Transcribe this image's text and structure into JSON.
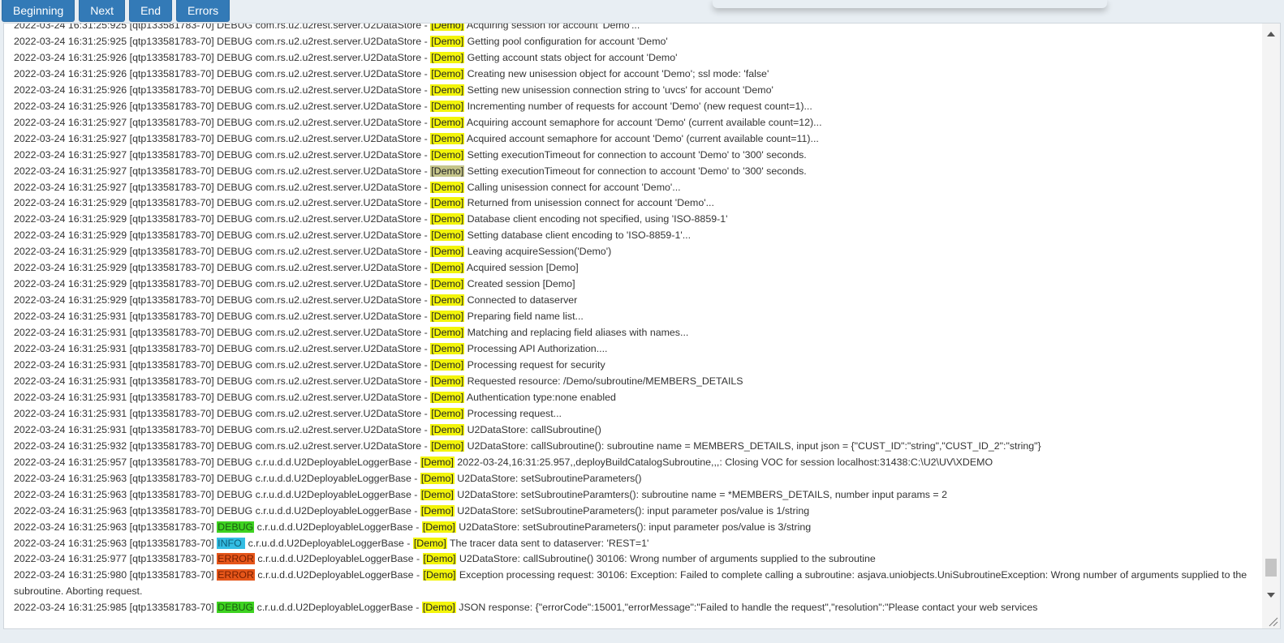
{
  "toolbar": {
    "buttons": [
      "Beginning",
      "Next",
      "End",
      "Errors"
    ]
  },
  "colors": {
    "debug_highlight": "#3ed321",
    "info_highlight": "#33bde3",
    "error_highlight": "#e5561a",
    "account_highlight": "#f3f50a",
    "button": "#337ab7"
  },
  "log": {
    "account_tag": "[Demo]",
    "lines": [
      {
        "ts": "2022-03-24 16:31:25:925",
        "thread": "[qtp133581783-70]",
        "level": "DEBUG",
        "logger": "com.rs.u2.u2rest.server.U2DataStore",
        "msg": "Acquiring session for account 'Demo'..."
      },
      {
        "ts": "2022-03-24 16:31:25:925",
        "thread": "[qtp133581783-70]",
        "level": "DEBUG",
        "logger": "com.rs.u2.u2rest.server.U2DataStore",
        "msg": "Getting pool configuration for account 'Demo'"
      },
      {
        "ts": "2022-03-24 16:31:25:926",
        "thread": "[qtp133581783-70]",
        "level": "DEBUG",
        "logger": "com.rs.u2.u2rest.server.U2DataStore",
        "msg": "Getting account stats object for account 'Demo'"
      },
      {
        "ts": "2022-03-24 16:31:25:926",
        "thread": "[qtp133581783-70]",
        "level": "DEBUG",
        "logger": "com.rs.u2.u2rest.server.U2DataStore",
        "msg": "Creating new unisession object for account 'Demo'; ssl mode: 'false'"
      },
      {
        "ts": "2022-03-24 16:31:25:926",
        "thread": "[qtp133581783-70]",
        "level": "DEBUG",
        "logger": "com.rs.u2.u2rest.server.U2DataStore",
        "msg": "Setting new unisession connection string to 'uvcs' for account 'Demo'"
      },
      {
        "ts": "2022-03-24 16:31:25:926",
        "thread": "[qtp133581783-70]",
        "level": "DEBUG",
        "logger": "com.rs.u2.u2rest.server.U2DataStore",
        "msg": "Incrementing number of requests for account 'Demo' (new request count=1)..."
      },
      {
        "ts": "2022-03-24 16:31:25:927",
        "thread": "[qtp133581783-70]",
        "level": "DEBUG",
        "logger": "com.rs.u2.u2rest.server.U2DataStore",
        "msg": "Acquiring account semaphore for account 'Demo' (current available count=12)..."
      },
      {
        "ts": "2022-03-24 16:31:25:927",
        "thread": "[qtp133581783-70]",
        "level": "DEBUG",
        "logger": "com.rs.u2.u2rest.server.U2DataStore",
        "msg": "Acquired account semaphore for account 'Demo' (current available count=11)..."
      },
      {
        "ts": "2022-03-24 16:31:25:927",
        "thread": "[qtp133581783-70]",
        "level": "DEBUG",
        "logger": "com.rs.u2.u2rest.server.U2DataStore",
        "msg": "Setting executionTimeout for connection to account 'Demo' to '300' seconds."
      },
      {
        "ts": "2022-03-24 16:31:25:927",
        "thread": "[qtp133581783-70]",
        "level": "DEBUG",
        "logger": "com.rs.u2.u2rest.server.U2DataStore",
        "msg": "Setting executionTimeout for connection to account 'Demo' to '300' seconds.",
        "selected": true
      },
      {
        "ts": "2022-03-24 16:31:25:927",
        "thread": "[qtp133581783-70]",
        "level": "DEBUG",
        "logger": "com.rs.u2.u2rest.server.U2DataStore",
        "msg": "Calling unisession connect for account 'Demo'..."
      },
      {
        "ts": "2022-03-24 16:31:25:929",
        "thread": "[qtp133581783-70]",
        "level": "DEBUG",
        "logger": "com.rs.u2.u2rest.server.U2DataStore",
        "msg": "Returned from unisession connect for account 'Demo'..."
      },
      {
        "ts": "2022-03-24 16:31:25:929",
        "thread": "[qtp133581783-70]",
        "level": "DEBUG",
        "logger": "com.rs.u2.u2rest.server.U2DataStore",
        "msg": "Database client encoding not specified, using 'ISO-8859-1'"
      },
      {
        "ts": "2022-03-24 16:31:25:929",
        "thread": "[qtp133581783-70]",
        "level": "DEBUG",
        "logger": "com.rs.u2.u2rest.server.U2DataStore",
        "msg": "Setting database client encoding to 'ISO-8859-1'..."
      },
      {
        "ts": "2022-03-24 16:31:25:929",
        "thread": "[qtp133581783-70]",
        "level": "DEBUG",
        "logger": "com.rs.u2.u2rest.server.U2DataStore",
        "msg": "Leaving acquireSession('Demo')"
      },
      {
        "ts": "2022-03-24 16:31:25:929",
        "thread": "[qtp133581783-70]",
        "level": "DEBUG",
        "logger": "com.rs.u2.u2rest.server.U2DataStore",
        "msg": "Acquired session [Demo]"
      },
      {
        "ts": "2022-03-24 16:31:25:929",
        "thread": "[qtp133581783-70]",
        "level": "DEBUG",
        "logger": "com.rs.u2.u2rest.server.U2DataStore",
        "msg": "Created session [Demo]"
      },
      {
        "ts": "2022-03-24 16:31:25:929",
        "thread": "[qtp133581783-70]",
        "level": "DEBUG",
        "logger": "com.rs.u2.u2rest.server.U2DataStore",
        "msg": "Connected to dataserver"
      },
      {
        "ts": "2022-03-24 16:31:25:931",
        "thread": "[qtp133581783-70]",
        "level": "DEBUG",
        "logger": "com.rs.u2.u2rest.server.U2DataStore",
        "msg": "Preparing field name list..."
      },
      {
        "ts": "2022-03-24 16:31:25:931",
        "thread": "[qtp133581783-70]",
        "level": "DEBUG",
        "logger": "com.rs.u2.u2rest.server.U2DataStore",
        "msg": "Matching and replacing field aliases with names..."
      },
      {
        "ts": "2022-03-24 16:31:25:931",
        "thread": "[qtp133581783-70]",
        "level": "DEBUG",
        "logger": "com.rs.u2.u2rest.server.U2DataStore",
        "msg": "Processing API Authorization...."
      },
      {
        "ts": "2022-03-24 16:31:25:931",
        "thread": "[qtp133581783-70]",
        "level": "DEBUG",
        "logger": "com.rs.u2.u2rest.server.U2DataStore",
        "msg": "Processing request for security"
      },
      {
        "ts": "2022-03-24 16:31:25:931",
        "thread": "[qtp133581783-70]",
        "level": "DEBUG",
        "logger": "com.rs.u2.u2rest.server.U2DataStore",
        "msg": "Requested resource: /Demo/subroutine/MEMBERS_DETAILS"
      },
      {
        "ts": "2022-03-24 16:31:25:931",
        "thread": "[qtp133581783-70]",
        "level": "DEBUG",
        "logger": "com.rs.u2.u2rest.server.U2DataStore",
        "msg": "Authentication type:none enabled"
      },
      {
        "ts": "2022-03-24 16:31:25:931",
        "thread": "[qtp133581783-70]",
        "level": "DEBUG",
        "logger": "com.rs.u2.u2rest.server.U2DataStore",
        "msg": "Processing request..."
      },
      {
        "ts": "2022-03-24 16:31:25:931",
        "thread": "[qtp133581783-70]",
        "level": "DEBUG",
        "logger": "com.rs.u2.u2rest.server.U2DataStore",
        "msg": "U2DataStore: callSubroutine()"
      },
      {
        "ts": "2022-03-24 16:31:25:932",
        "thread": "[qtp133581783-70]",
        "level": "DEBUG",
        "logger": "com.rs.u2.u2rest.server.U2DataStore",
        "msg": "U2DataStore: callSubroutine(): subroutine name = MEMBERS_DETAILS, input json = {\"CUST_ID\":\"string\",\"CUST_ID_2\":\"string\"}"
      },
      {
        "ts": "2022-03-24 16:31:25:957",
        "thread": "[qtp133581783-70]",
        "level": "DEBUG",
        "logger": "c.r.u.d.d.U2DeployableLoggerBase",
        "msg": "2022-03-24,16:31:25.957,,deployBuildCatalogSubroutine,,,: Closing VOC for session localhost:31438:C:\\U2\\UV\\XDEMO"
      },
      {
        "ts": "2022-03-24 16:31:25:963",
        "thread": "[qtp133581783-70]",
        "level": "DEBUG",
        "logger": "c.r.u.d.d.U2DeployableLoggerBase",
        "msg": "U2DataStore: setSubroutineParameters()"
      },
      {
        "ts": "2022-03-24 16:31:25:963",
        "thread": "[qtp133581783-70]",
        "level": "DEBUG",
        "logger": "c.r.u.d.d.U2DeployableLoggerBase",
        "msg": "U2DataStore: setSubroutineParamters(): subroutine name = *MEMBERS_DETAILS, number input params = 2"
      },
      {
        "ts": "2022-03-24 16:31:25:963",
        "thread": "[qtp133581783-70]",
        "level": "DEBUG",
        "logger": "c.r.u.d.d.U2DeployableLoggerBase",
        "msg": "U2DataStore: setSubroutineParameters(): input parameter pos/value is 1/string"
      },
      {
        "ts": "2022-03-24 16:31:25:963",
        "thread": "[qtp133581783-70]",
        "level": "DEBUG",
        "logger": "c.r.u.d.d.U2DeployableLoggerBase",
        "msg": "U2DataStore: setSubroutineParameters(): input parameter pos/value is 3/string",
        "level_hl": "debug"
      },
      {
        "ts": "2022-03-24 16:31:25:963",
        "thread": "[qtp133581783-70]",
        "level": "INFO ",
        "logger": "c.r.u.d.d.U2DeployableLoggerBase",
        "msg": "The tracer data sent to dataserver: 'REST=1'",
        "level_hl": "info"
      },
      {
        "ts": "2022-03-24 16:31:25:977",
        "thread": "[qtp133581783-70]",
        "level": "ERROR",
        "logger": "c.r.u.d.d.U2DeployableLoggerBase",
        "msg": "U2DataStore: callSubroutine() 30106: Wrong number of arguments supplied to the subroutine",
        "level_hl": "error"
      },
      {
        "ts": "2022-03-24 16:31:25:980",
        "thread": "[qtp133581783-70]",
        "level": "ERROR",
        "logger": "c.r.u.d.d.U2DeployableLoggerBase",
        "msg": "Exception processing request: 30106: Exception: Failed to complete calling a subroutine: asjava.uniobjects.UniSubroutineException: Wrong number of arguments supplied to the subroutine. Aborting request.",
        "level_hl": "error"
      },
      {
        "ts": "2022-03-24 16:31:25:985",
        "thread": "[qtp133581783-70]",
        "level": "DEBUG",
        "logger": "c.r.u.d.d.U2DeployableLoggerBase",
        "msg": "JSON response: {\"errorCode\":15001,\"errorMessage\":\"Failed to handle the request\",\"resolution\":\"Please contact your web services",
        "level_hl": "debug"
      }
    ]
  }
}
